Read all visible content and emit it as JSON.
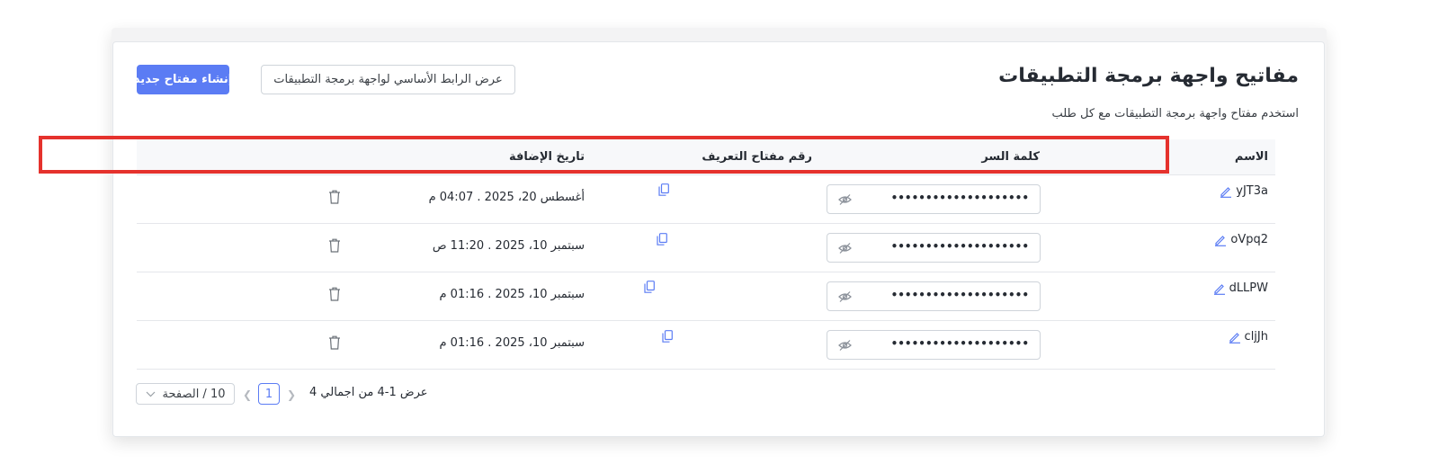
{
  "header": {
    "title": "مفاتيح واجهة برمجة التطبيقات",
    "subtitle": "استخدم مفتاح واجهة برمجة التطبيقات مع كل طلب",
    "create_button": "إنشاء مفتاح جديد",
    "base_url_button": "عرض الرابط الأساسي لواجهة برمجة التطبيقات"
  },
  "table": {
    "columns": {
      "name": "الاسم",
      "password": "كلمة السر",
      "key_id": "رقم مفتاح التعريف",
      "date_added": "تاريخ الإضافة"
    },
    "rows": [
      {
        "name": "yJT3a",
        "password_mask": "••••••••••••••••••••",
        "date": "أغسطس 20، 2025 . 04:07 م"
      },
      {
        "name": "oVpq2",
        "password_mask": "••••••••••••••••••••",
        "date": "سبتمبر 10، 2025 . 11:20 ص"
      },
      {
        "name": "dLLPW",
        "password_mask": "••••••••••••••••••••",
        "date": "سبتمبر 10، 2025 . 01:16 م"
      },
      {
        "name": "cljJh",
        "password_mask": "••••••••••••••••••••",
        "date": "سبتمبر 10، 2025 . 01:16 م"
      }
    ]
  },
  "pagination": {
    "summary": "عرض 1-4 من اجمالي 4",
    "current_page": "1",
    "page_size": "10 / الصفحة"
  },
  "colors": {
    "primary": "#5b7cf4",
    "highlight": "#e5322d"
  },
  "icons": [
    "edit-icon",
    "eye-off-icon",
    "copy-icon",
    "trash-icon",
    "chevron-left-icon",
    "chevron-right-icon",
    "chevron-down-icon"
  ]
}
